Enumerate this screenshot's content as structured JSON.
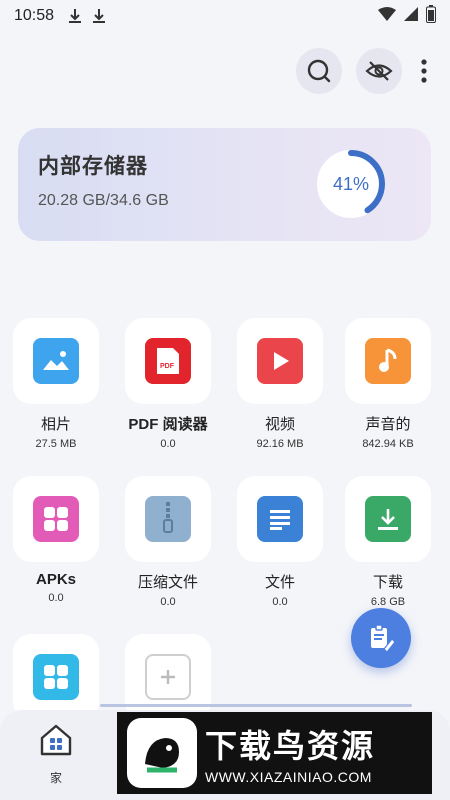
{
  "status": {
    "time": "10:58"
  },
  "storage": {
    "title": "内部存储器",
    "size": "20.28 GB/34.6 GB",
    "percent": "41%",
    "fraction": 0.41,
    "ring_color": "#3e6fc6"
  },
  "categories": [
    {
      "name": "相片",
      "size": "27.5 MB",
      "color": "#3fa4ee",
      "icon": "image-icon"
    },
    {
      "name": "PDF 阅读器",
      "size": "0.0",
      "color": "#e2252d",
      "icon": "pdf-icon"
    },
    {
      "name": "视频",
      "size": "92.16 MB",
      "color": "#e9454a",
      "icon": "play-icon"
    },
    {
      "name": "声音的",
      "size": "842.94 KB",
      "color": "#f7943a",
      "icon": "music-note-icon"
    },
    {
      "name": "APKs",
      "size": "0.0",
      "color": "#e25bb7",
      "icon": "apps-icon"
    },
    {
      "name": "压缩文件",
      "size": "0.0",
      "color": "#8fb0cf",
      "icon": "zip-icon"
    },
    {
      "name": "文件",
      "size": "0.0",
      "color": "#3b82d6",
      "icon": "document-icon"
    },
    {
      "name": "下载",
      "size": "6.8 GB",
      "color": "#3aa866",
      "icon": "download-icon"
    },
    {
      "name": "",
      "size": "",
      "color": "#33b9e7",
      "icon": "apps-icon"
    },
    {
      "name": "",
      "size": "",
      "color": "#ffffff",
      "icon": "add-icon"
    }
  ],
  "nav": {
    "home_label": "家"
  },
  "watermark": {
    "brand": "下载鸟资源",
    "url": "WWW.XIAZAINIAO.COM"
  }
}
